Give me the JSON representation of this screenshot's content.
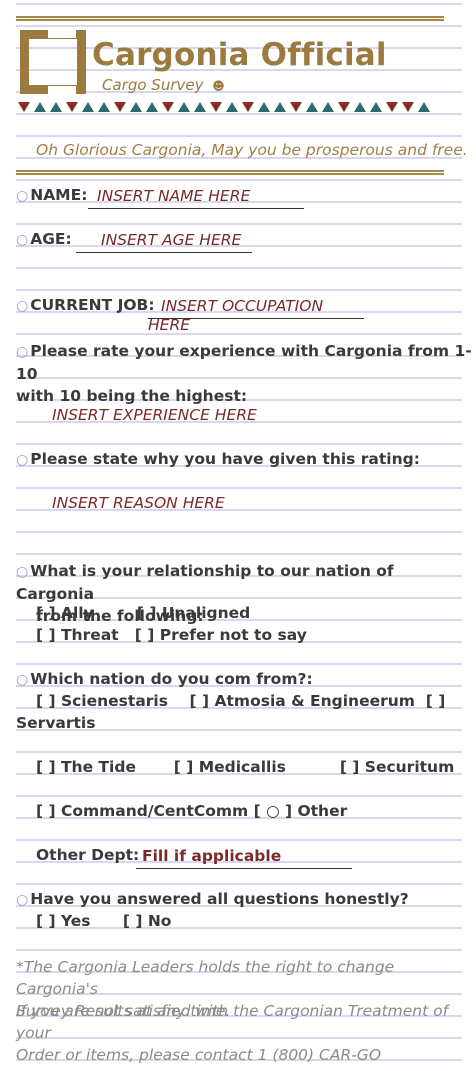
{
  "header": {
    "title": "Cargonia Official",
    "subtitle": "Cargo Survey",
    "subtitle_icon": "☻",
    "motto": "Oh Glorious Cargonia, May you be prosperous and free."
  },
  "colors": {
    "gold": "#9a7a3e",
    "red_triangle": "#8b2a26",
    "teal_triangle": "#2e6b6e",
    "fill_text": "#7a2a2a"
  },
  "form": {
    "name_label": "NAME:",
    "name_value": "INSERT NAME HERE",
    "age_label": "AGE:",
    "age_value": "INSERT AGE HERE",
    "job_label": "CURRENT JOB:",
    "job_value": "INSERT OCCUPATION HERE",
    "rate_q_line1": "Please rate your experience with Cargonia from 1-10",
    "rate_q_line2": "with 10 being the highest:",
    "rate_value": "INSERT EXPERIENCE HERE",
    "reason_q": "Please state why you have given this rating:",
    "reason_value": "INSERT REASON HERE",
    "relation_q_line1": "What is your relationship to our nation of Cargonia",
    "relation_q_line2": "from the following:",
    "relation_opts_row1": "[ ] Ally        [ ] Unaligned",
    "relation_opts_row2": "[ ] Threat   [ ] Prefer not to say",
    "nation_q": "Which nation do you com from?:",
    "nation_row1": "[ ] Scienestaris    [ ] Atmosia & Engineerum  [ ]",
    "nation_row1b": "Servartis",
    "nation_row2": "[ ] The Tide       [ ] Medicallis          [ ] Securitum",
    "nation_row3": "[ ] Command/CentComm [ ○ ] Other",
    "other_dept_label": "Other Dept:",
    "other_dept_value": "Fill if applicable",
    "honest_q": "Have you answered all questions honestly?",
    "honest_opts": "[ ] Yes      [ ] No",
    "bullet": "○"
  },
  "footer": {
    "note1_line1": "*The Cargonia Leaders holds the right to change Cargonia's",
    "note1_line2": "Survey Results at any time.",
    "note2_line1": "If you are not satisfied with the Cargonian Treatment of your",
    "note2_line2": "Order or items, please contact 1 (800) CAR-GO"
  }
}
